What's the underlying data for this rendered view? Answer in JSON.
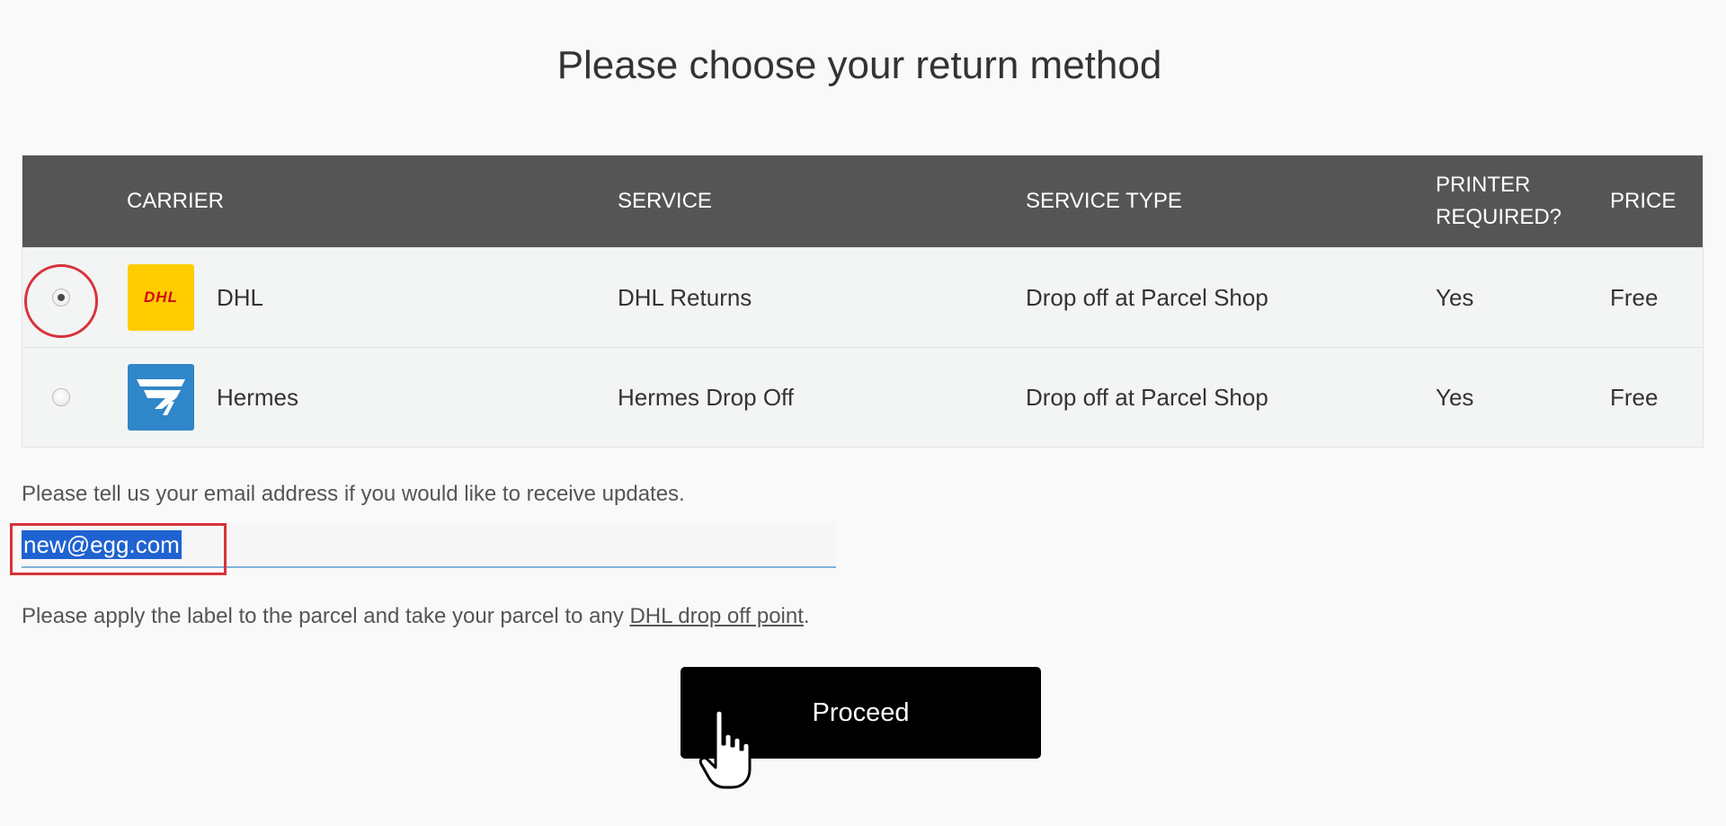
{
  "page": {
    "title": "Please choose your return method"
  },
  "table": {
    "headers": {
      "carrier": "CARRIER",
      "service": "SERVICE",
      "service_type": "SERVICE TYPE",
      "printer_required": "PRINTER REQUIRED?",
      "price": "PRICE"
    },
    "rows": [
      {
        "selected": true,
        "logo_text": "DHL",
        "logo_icon": "dhl-logo-icon",
        "carrier": "DHL",
        "service": "DHL Returns",
        "service_type": "Drop off at Parcel Shop",
        "printer_required": "Yes",
        "price": "Free",
        "logo_bg": "#ffcc00",
        "logo_fg": "#d40511"
      },
      {
        "selected": false,
        "logo_icon": "hermes-logo-icon",
        "carrier": "Hermes",
        "service": "Hermes Drop Off",
        "service_type": "Drop off at Parcel Shop",
        "printer_required": "Yes",
        "price": "Free",
        "logo_bg": "#2f86c9"
      }
    ]
  },
  "email": {
    "prompt": "Please tell us your email address if you would like to receive updates.",
    "value": "new@egg.com"
  },
  "instructions": {
    "text_before": "Please apply the label to the parcel and take your parcel to any ",
    "link": "DHL drop off point",
    "text_after": "."
  },
  "proceed": {
    "label": "Proceed"
  },
  "colors": {
    "header_bg": "#555555",
    "highlight_red": "#d8323a",
    "selection_blue": "#1f62d1",
    "button_bg": "#000000"
  }
}
